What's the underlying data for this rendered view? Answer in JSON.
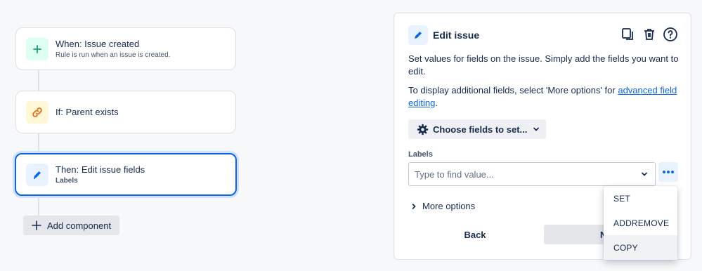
{
  "flow": {
    "trigger": {
      "title": "When: Issue created",
      "subtitle": "Rule is run when an issue is created."
    },
    "condition": {
      "title": "If: Parent exists"
    },
    "action": {
      "title": "Then: Edit issue fields",
      "subtitle": "Labels"
    },
    "add_component_label": "Add component"
  },
  "panel": {
    "title": "Edit issue",
    "description": "Set values for fields on the issue. Simply add the fields you want to edit.",
    "display_prefix": "To display additional fields, select 'More options' for ",
    "display_link": "advanced field editing",
    "display_suffix": ".",
    "choose_fields_label": "Choose fields to set...",
    "field_label": "Labels",
    "field_placeholder": "Type to find value...",
    "more_options_label": "More options",
    "back_label": "Back",
    "next_label": "N"
  },
  "menu": {
    "items": [
      "SET",
      "ADDREMOVE",
      "COPY"
    ],
    "highlighted": "COPY"
  },
  "colors": {
    "accent": "#0c66e4",
    "trigger_icon_bg": "#dcfff1",
    "trigger_icon": "#22a06b",
    "condition_icon_bg": "#fff7d6",
    "condition_icon": "#e56910",
    "action_icon_bg": "#e9f2ff"
  }
}
